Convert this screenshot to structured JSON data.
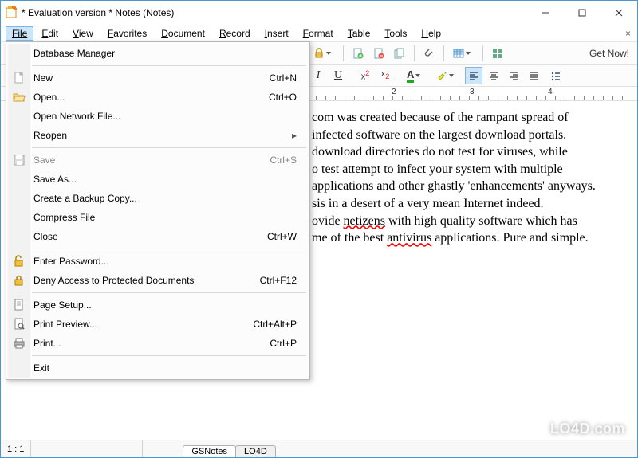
{
  "title": "* Evaluation version * Notes (Notes)",
  "menubar": [
    "File",
    "Edit",
    "View",
    "Favorites",
    "Document",
    "Record",
    "Insert",
    "Format",
    "Table",
    "Tools",
    "Help"
  ],
  "getnow": "Get Now!",
  "file_menu": {
    "dbmgr": "Database Manager",
    "new": "New",
    "new_s": "Ctrl+N",
    "open": "Open...",
    "open_s": "Ctrl+O",
    "opennet": "Open Network File...",
    "reopen": "Reopen",
    "save": "Save",
    "save_s": "Ctrl+S",
    "saveas": "Save As...",
    "backup": "Create a Backup Copy...",
    "compress": "Compress File",
    "close": "Close",
    "close_s": "Ctrl+W",
    "enterpw": "Enter Password...",
    "deny": "Deny Access to Protected Documents",
    "deny_s": "Ctrl+F12",
    "pagesetup": "Page Setup...",
    "preview": "Print Preview...",
    "preview_s": "Ctrl+Alt+P",
    "print": "Print...",
    "print_s": "Ctrl+P",
    "exit": "Exit"
  },
  "ruler_nums": [
    "2",
    "3",
    "4"
  ],
  "document": {
    "l1": "com was created because of the rampant spread of",
    "l2": "infected software on the largest download portals.",
    "l3": "download directories do not test for viruses, while",
    "l4": "o test attempt to infect your system with multiple",
    "l5": "applications and other ghastly 'enhancements' anyways.",
    "l6a": "sis in a desert of a very mean Internet indeed.",
    "l7a": "ovide ",
    "l7b": "netizens",
    "l7c": " with high quality software which has",
    "l8a": "me of the best ",
    "l8b": "antivirus",
    "l8c": " applications. Pure and simple."
  },
  "status": {
    "pos": "1 : 1"
  },
  "tabs": [
    "GSNotes",
    "LO4D"
  ],
  "watermark": "LO4D.com"
}
